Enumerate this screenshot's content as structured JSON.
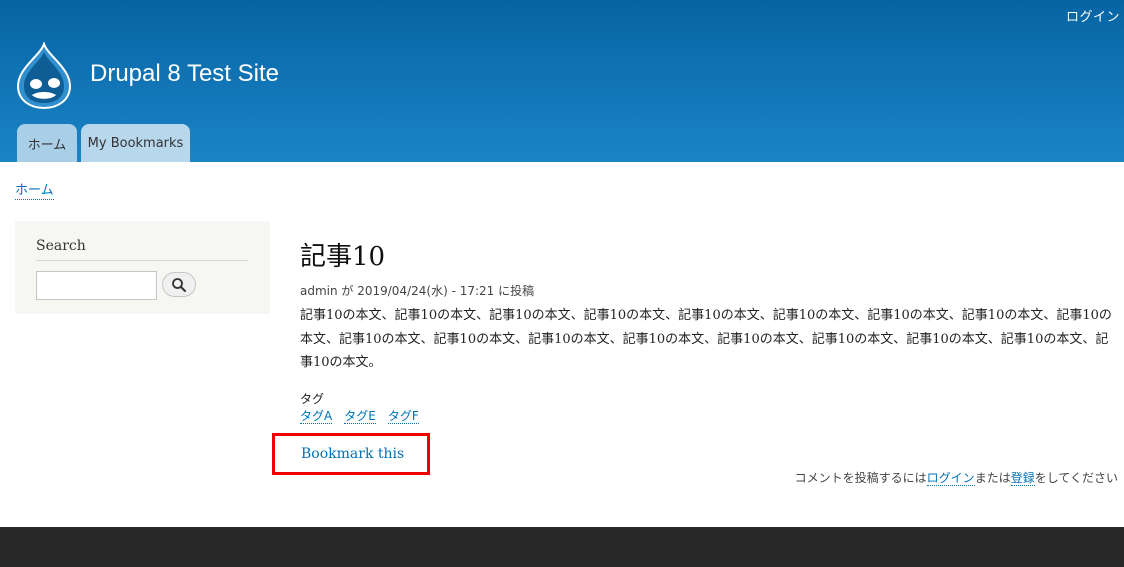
{
  "header": {
    "user_menu": {
      "login": "ログイン"
    },
    "site_name": "Drupal 8 Test Site",
    "tabs": [
      {
        "label": "ホーム"
      },
      {
        "label": "My Bookmarks"
      }
    ]
  },
  "breadcrumb": {
    "home": "ホーム"
  },
  "sidebar": {
    "search": {
      "title": "Search",
      "value": ""
    }
  },
  "article": {
    "title": "記事10",
    "submitted": "admin が 2019/04/24(水) - 17:21 に投稿",
    "body": "記事10の本文、記事10の本文、記事10の本文、記事10の本文、記事10の本文、記事10の本文、記事10の本文、記事10の本文、記事10の本文、記事10の本文、記事10の本文、記事10の本文、記事10の本文、記事10の本文、記事10の本文、記事10の本文、記事10の本文、記事10の本文。",
    "tags_label": "タグ",
    "tags": [
      "タグA",
      "タグE",
      "タグF"
    ],
    "bookmark_link": "Bookmark this"
  },
  "comment_notice": {
    "prefix": "コメントを投稿するには",
    "login_link": "ログイン",
    "middle": "または",
    "register_link": "登録",
    "suffix": "をしてください"
  },
  "colors": {
    "header_top": "#0664a3",
    "header_bottom": "#1b84c7",
    "link": "#0071b3",
    "highlight": "#ee0000",
    "footer": "#292929"
  }
}
